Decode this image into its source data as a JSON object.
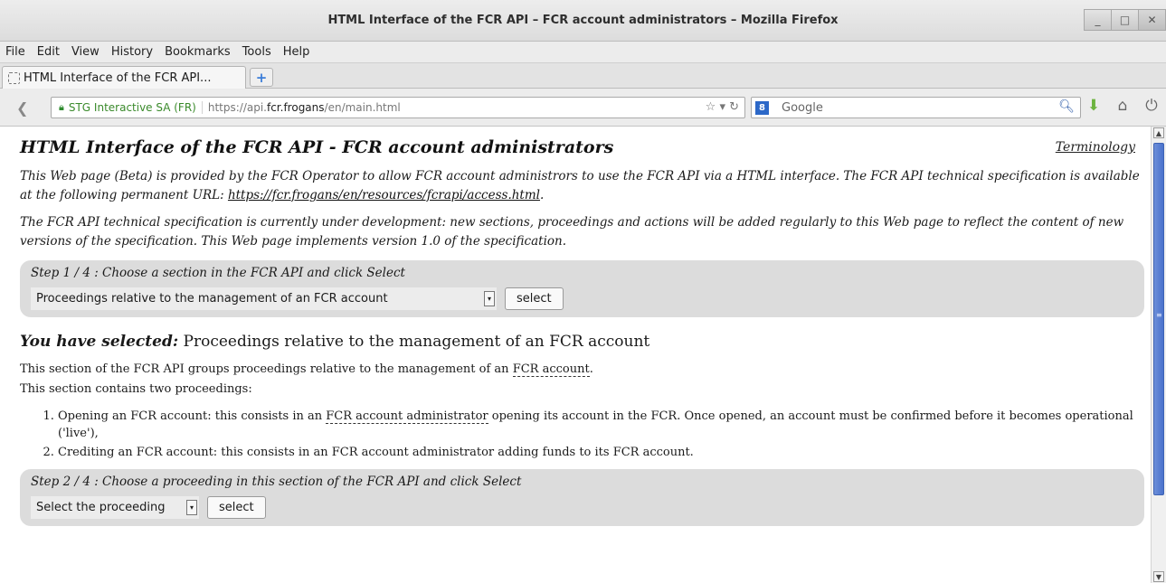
{
  "window": {
    "title": "HTML Interface of the FCR API – FCR account administrators – Mozilla Firefox",
    "buttons": {
      "minimize": "_",
      "maximize": "□",
      "close": "✕"
    }
  },
  "menu": [
    "File",
    "Edit",
    "View",
    "History",
    "Bookmarks",
    "Tools",
    "Help"
  ],
  "tabs": [
    {
      "label": "HTML Interface of the FCR API..."
    }
  ],
  "new_tab_label": "+",
  "navbar": {
    "identity": "STG Interactive SA (FR)",
    "url_prefix": "https://api.",
    "url_host": "fcr.frogans",
    "url_path": "/en/main.html",
    "url_controls": "☆ ▾ ↻",
    "search_engine_badge": "8",
    "search_placeholder": "Google",
    "icons": [
      "search-icon",
      "download-icon",
      "home-icon",
      "addon-icon"
    ]
  },
  "page": {
    "title": "HTML Interface of the FCR API - FCR account administrators",
    "terminology_link": "Terminology",
    "intro1_text": "This Web page (Beta) is provided by the FCR Operator to allow FCR account administrors to use the FCR API via a HTML interface. The FCR API technical specification is available at the following permanent URL: ",
    "intro1_link": "https://fcr.frogans/en/resources/fcrapi/access.html",
    "intro1_end": ".",
    "intro2": "The FCR API technical specification is currently under development: new sections, proceedings and actions will be added regularly to this Web page to reflect the content of new versions of the specification. This Web page implements version 1.0 of the specification.",
    "step1": {
      "title": "Step 1 / 4 : Choose a section in the FCR API and click Select",
      "selected_value": "Proceedings relative to the management of an FCR account",
      "button": "select"
    },
    "selected_label": "You have selected:",
    "selected_value": "Proceedings relative to the management of an FCR account",
    "section_desc_1": "This section of the FCR API groups proceedings relative to the management of an ",
    "section_desc_1_term": "FCR account",
    "section_desc_1_end": ".",
    "section_desc_2": "This section contains two proceedings:",
    "proceedings": [
      {
        "before": "Opening an FCR account: this consists in an ",
        "term": "FCR account administrator",
        "after": " opening its account in the FCR. Once opened, an account must be confirmed before it becomes operational ('live'),"
      },
      {
        "before": "Crediting an FCR account: this consists in an FCR account administrator adding funds to its FCR account.",
        "term": "",
        "after": ""
      }
    ],
    "step2": {
      "title": "Step 2 / 4 : Choose a proceeding in this section of the FCR API and click Select",
      "selected_value": "Select the proceeding",
      "button": "select"
    }
  },
  "colors": {
    "scroll_thumb": "#4a72cc",
    "step_box_bg": "#dcdcdc",
    "identity_green": "#3a8a2b"
  }
}
